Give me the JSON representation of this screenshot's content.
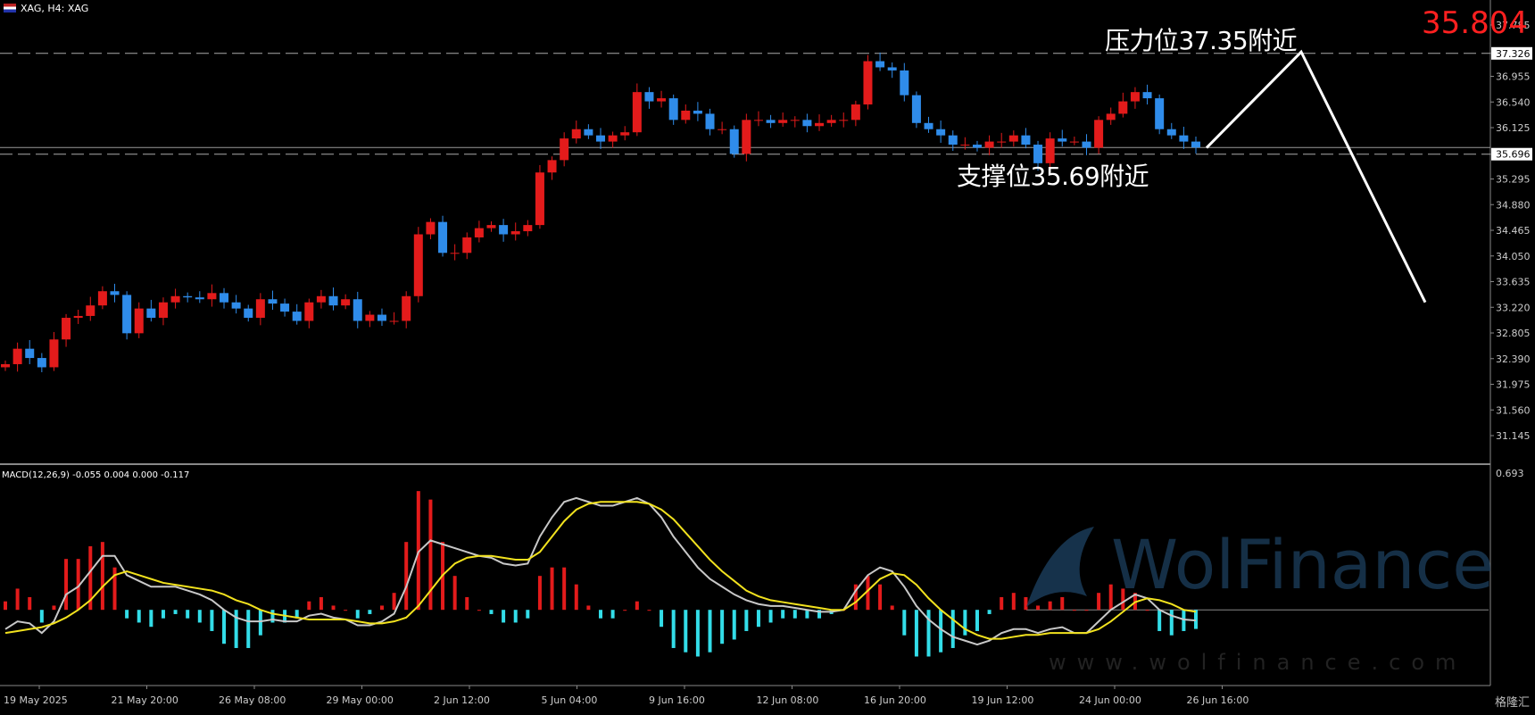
{
  "header": {
    "symbol_text": "XAG, H4:  XAG"
  },
  "macd_label": "MACD(12,26,9) -0.055 0.004 0.000 -0.117",
  "current_price": "35.804",
  "annotations": {
    "resistance": "压力位37.35附近",
    "support": "支撑位35.69附近"
  },
  "watermark": {
    "brand": "WolFinance",
    "url": "www.wolfinance.com"
  },
  "corner_logo": "格隆汇",
  "colors": {
    "up": "#e31b1b",
    "down": "#2f8cea",
    "macd_up": "#e31b1b",
    "macd_down": "#33dde8",
    "macd_line": "#c8c8c8",
    "signal_line": "#f2e21e",
    "annotation": "#ffffff"
  },
  "chart_data": {
    "type": "candlestick",
    "price_axis_ticks": [
      37.785,
      37.326,
      36.955,
      36.54,
      36.125,
      35.696,
      35.295,
      34.88,
      34.465,
      34.05,
      33.635,
      33.22,
      32.805,
      32.39,
      31.975,
      31.56,
      31.145
    ],
    "resistance_level": 37.326,
    "support_level": 35.696,
    "current_price": 35.804,
    "x_labels": [
      "19 May 2025",
      "21 May 20:00",
      "26 May 08:00",
      "29 May 00:00",
      "2 Jun 12:00",
      "5 Jun 04:00",
      "9 Jun 16:00",
      "12 Jun 08:00",
      "16 Jun 20:00",
      "19 Jun 12:00",
      "24 Jun 00:00",
      "26 Jun 16:00"
    ],
    "closes": [
      32.3,
      32.55,
      32.4,
      32.25,
      32.7,
      33.05,
      33.08,
      33.25,
      33.48,
      33.42,
      32.8,
      33.2,
      33.05,
      33.3,
      33.4,
      33.38,
      33.35,
      33.45,
      33.3,
      33.2,
      33.05,
      33.35,
      33.28,
      33.15,
      33.0,
      33.3,
      33.4,
      33.25,
      33.35,
      33.0,
      33.1,
      33.0,
      33.0,
      33.4,
      34.4,
      34.6,
      34.1,
      34.1,
      34.35,
      34.5,
      34.55,
      34.4,
      34.45,
      34.55,
      35.4,
      35.6,
      35.95,
      36.1,
      36.0,
      35.9,
      36.0,
      36.05,
      36.7,
      36.55,
      36.6,
      36.25,
      36.4,
      36.35,
      36.1,
      36.1,
      35.7,
      36.25,
      36.25,
      36.2,
      36.25,
      36.25,
      36.15,
      36.2,
      36.25,
      36.25,
      36.5,
      37.2,
      37.1,
      37.05,
      36.65,
      36.2,
      36.1,
      36.0,
      35.85,
      35.85,
      35.8,
      35.9,
      35.9,
      36.0,
      35.85,
      35.55,
      35.95,
      35.9,
      35.9,
      35.8,
      36.25,
      36.35,
      36.55,
      36.7,
      36.6,
      36.1,
      36.0,
      35.9,
      35.804
    ],
    "macd": {
      "y_max_label": "0.693",
      "line_zero_ref": 0.0,
      "macd_line": [
        -0.1,
        -0.06,
        -0.07,
        -0.12,
        -0.06,
        0.08,
        0.12,
        0.2,
        0.28,
        0.28,
        0.18,
        0.15,
        0.12,
        0.12,
        0.12,
        0.1,
        0.08,
        0.05,
        0.0,
        -0.04,
        -0.06,
        -0.06,
        -0.05,
        -0.06,
        -0.06,
        -0.03,
        -0.02,
        -0.04,
        -0.05,
        -0.08,
        -0.08,
        -0.06,
        -0.02,
        0.12,
        0.3,
        0.36,
        0.34,
        0.32,
        0.3,
        0.28,
        0.27,
        0.24,
        0.23,
        0.24,
        0.38,
        0.48,
        0.56,
        0.58,
        0.56,
        0.54,
        0.54,
        0.56,
        0.58,
        0.55,
        0.48,
        0.38,
        0.3,
        0.22,
        0.16,
        0.12,
        0.08,
        0.05,
        0.03,
        0.02,
        0.02,
        0.01,
        0.0,
        -0.01,
        -0.01,
        0.0,
        0.1,
        0.18,
        0.22,
        0.2,
        0.12,
        0.02,
        -0.05,
        -0.1,
        -0.14,
        -0.16,
        -0.18,
        -0.16,
        -0.12,
        -0.1,
        -0.1,
        -0.12,
        -0.1,
        -0.09,
        -0.12,
        -0.12,
        -0.06,
        0.0,
        0.04,
        0.08,
        0.06,
        0.0,
        -0.03,
        -0.05,
        -0.055
      ],
      "signal_line": [
        -0.12,
        -0.11,
        -0.1,
        -0.09,
        -0.07,
        -0.04,
        0.0,
        0.05,
        0.12,
        0.18,
        0.2,
        0.18,
        0.16,
        0.14,
        0.13,
        0.12,
        0.11,
        0.1,
        0.08,
        0.05,
        0.03,
        0.0,
        -0.02,
        -0.03,
        -0.04,
        -0.05,
        -0.05,
        -0.05,
        -0.05,
        -0.06,
        -0.07,
        -0.07,
        -0.06,
        -0.04,
        0.02,
        0.1,
        0.18,
        0.24,
        0.27,
        0.28,
        0.28,
        0.27,
        0.26,
        0.26,
        0.3,
        0.38,
        0.46,
        0.52,
        0.55,
        0.56,
        0.56,
        0.56,
        0.56,
        0.55,
        0.52,
        0.47,
        0.4,
        0.33,
        0.26,
        0.2,
        0.15,
        0.1,
        0.07,
        0.05,
        0.04,
        0.03,
        0.02,
        0.01,
        0.0,
        0.0,
        0.04,
        0.1,
        0.16,
        0.19,
        0.18,
        0.13,
        0.06,
        0.0,
        -0.05,
        -0.1,
        -0.13,
        -0.15,
        -0.15,
        -0.14,
        -0.13,
        -0.13,
        -0.12,
        -0.12,
        -0.12,
        -0.12,
        -0.1,
        -0.06,
        -0.01,
        0.04,
        0.06,
        0.05,
        0.03,
        0.0,
        -0.01
      ]
    },
    "projection": {
      "type": "line",
      "points_price": [
        35.8,
        37.35,
        33.3
      ]
    }
  }
}
